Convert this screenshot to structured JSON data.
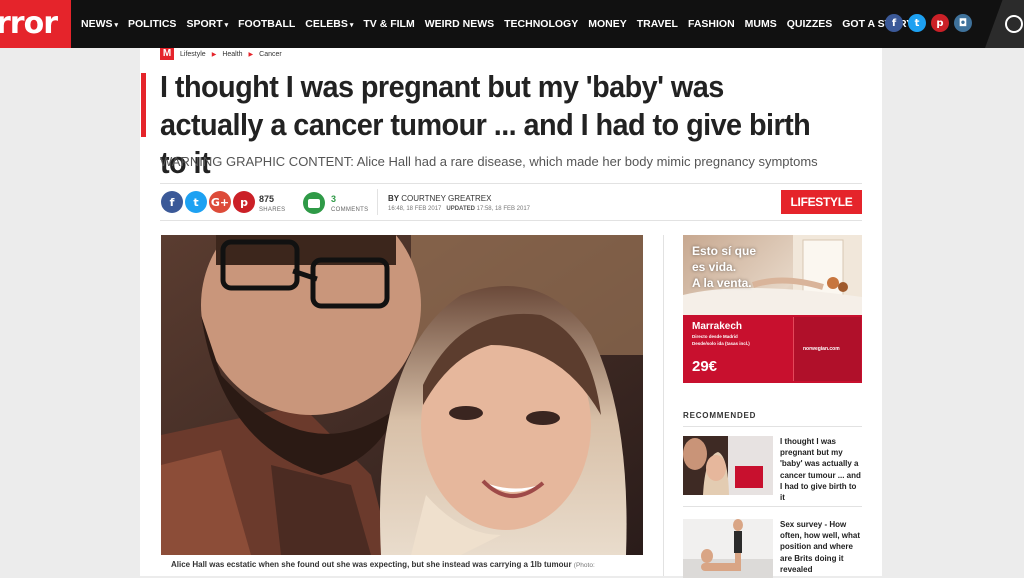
{
  "site": {
    "logo_text": "rror"
  },
  "nav": {
    "items": [
      {
        "label": "NEWS",
        "dropdown": true
      },
      {
        "label": "POLITICS",
        "dropdown": false
      },
      {
        "label": "SPORT",
        "dropdown": true
      },
      {
        "label": "FOOTBALL",
        "dropdown": false
      },
      {
        "label": "CELEBS",
        "dropdown": true
      },
      {
        "label": "TV & FILM",
        "dropdown": false
      },
      {
        "label": "WEIRD NEWS",
        "dropdown": false
      },
      {
        "label": "TECHNOLOGY",
        "dropdown": false
      },
      {
        "label": "MONEY",
        "dropdown": false
      },
      {
        "label": "TRAVEL",
        "dropdown": false
      },
      {
        "label": "FASHION",
        "dropdown": false
      },
      {
        "label": "MUMS",
        "dropdown": false
      },
      {
        "label": "QUIZZES",
        "dropdown": false
      },
      {
        "label": "GOT A STORY?",
        "dropdown": false
      }
    ],
    "caret": "▾"
  },
  "social_top": [
    {
      "name": "facebook-icon",
      "glyph": "f",
      "color": "#3b5998"
    },
    {
      "name": "twitter-icon",
      "glyph": "t",
      "color": "#1da1f2"
    },
    {
      "name": "pinterest-icon",
      "glyph": "p",
      "color": "#cb2027"
    },
    {
      "name": "instagram-icon",
      "glyph": "◘",
      "color": "#3f729b"
    }
  ],
  "breadcrumb": {
    "logo": "M",
    "items": [
      "Lifestyle",
      "Health",
      "Cancer"
    ],
    "arrow": "▶"
  },
  "article": {
    "headline": "I thought I was pregnant but my 'baby' was actually a cancer tumour ... and I had to give birth to it",
    "subheading": "WARNING GRAPHIC CONTENT: Alice Hall had a rare disease, which made her body mimic pregnancy symptoms",
    "shares_count": "875",
    "shares_label": "SHARES",
    "comments_count": "3",
    "comments_label": "COMMENTS",
    "by_label": "BY",
    "author": "COURTNEY GREATREX",
    "published": "16:48, 18 FEB 2017",
    "updated_label": "UPDATED",
    "updated": "17:58, 18 FEB 2017",
    "section": "LIFESTYLE",
    "caption": "Alice Hall was ecstatic when she found out she was expecting, but she instead was carrying a 1lb tumour",
    "photo_credit": "(Photo:"
  },
  "share_icons": [
    {
      "name": "facebook-share-icon",
      "glyph": "f",
      "color": "#3b5998"
    },
    {
      "name": "twitter-share-icon",
      "glyph": "t",
      "color": "#1da1f2"
    },
    {
      "name": "googleplus-share-icon",
      "glyph": "G+",
      "color": "#dd4b39"
    },
    {
      "name": "pinterest-share-icon",
      "glyph": "p",
      "color": "#cb2027"
    }
  ],
  "ad": {
    "slogan_lines": [
      "Esto sí que",
      "es vida.",
      "A la venta."
    ],
    "destination": "Marrakech",
    "line1": "Directo desde Madrid",
    "line2": "Desde/solo ida (tasas incl.)",
    "price": "29€",
    "brand": "norwegian.com"
  },
  "recommended": {
    "title": "RECOMMENDED",
    "items": [
      {
        "text": "I thought I was pregnant but my 'baby' was actually a cancer tumour ... and I had to give birth to it"
      },
      {
        "text": "Sex survey - How often, how well, what position and where are Brits doing it revealed"
      }
    ]
  }
}
